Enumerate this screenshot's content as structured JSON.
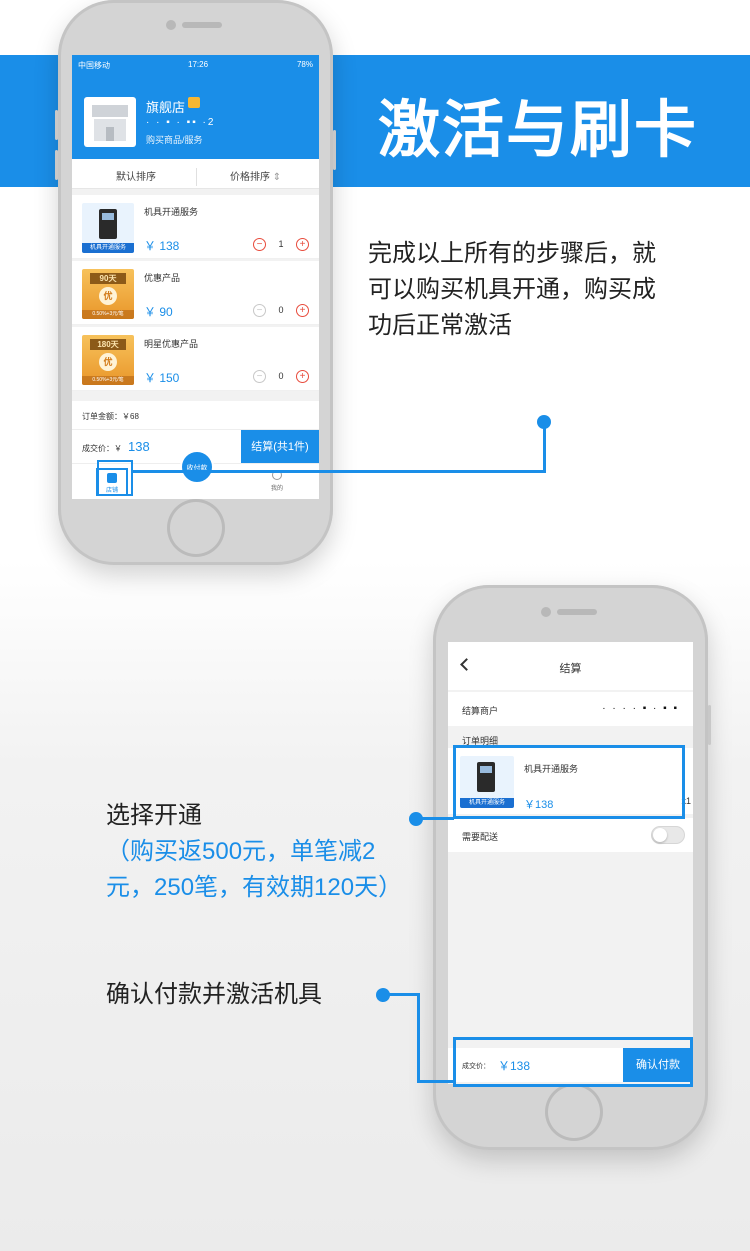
{
  "banner": {
    "title": "激活与刷卡"
  },
  "annotations": {
    "top_note": [
      "完成以上所有的步骤后，就",
      "可以购买机具开通，购买成",
      "功后正常激活"
    ],
    "select_title": "选择开通",
    "select_detail": [
      "（购买返500元，单笔减2",
      "元，250笔，有效期120天）"
    ],
    "confirm_note": "确认付款并激活机具"
  },
  "phone1": {
    "status": {
      "carrier": "中国移动",
      "time": "17:26",
      "battery": "78%"
    },
    "store": {
      "name": "旗舰店",
      "id": "· · ▪ · ▪▪ ·2",
      "subtitle": "购买商品/服务"
    },
    "sort": {
      "default": "默认排序",
      "price": "价格排序"
    },
    "products": [
      {
        "name": "机具开通服务",
        "price": "￥ 138",
        "qty": "1",
        "thumb_label": "机具开通服务"
      },
      {
        "name": "优惠产品",
        "price": "￥ 90",
        "qty": "0",
        "thumb_days": "90天",
        "thumb_badge": "优",
        "thumb_cap": "0.50%+3元/笔"
      },
      {
        "name": "明星优惠产品",
        "price": "￥ 150",
        "qty": "0",
        "thumb_days": "180天",
        "thumb_badge": "优",
        "thumb_cap": "0.50%+3元/笔"
      }
    ],
    "order_total": "订单金额：￥68",
    "deal_label": "成交价：￥",
    "deal_price": "138",
    "pay_button": "结算(共1件)",
    "tabs": {
      "store": "店铺",
      "collect": "收付款",
      "mine": "我的"
    }
  },
  "phone2": {
    "title": "结算",
    "merchant_label": "结算商户",
    "merchant_value": "· · · · ▪ · ▪ ▪",
    "detail_label": "订单明细",
    "item": {
      "name": "机具开通服务",
      "price": "￥138",
      "qty": "x1",
      "thumb_label": "机具开通服务"
    },
    "delivery_label": "需要配送",
    "bottom_label": "成交价：",
    "bottom_price": "￥138",
    "confirm_button": "确认付款"
  },
  "colors": {
    "accent": "#1a8ee8",
    "minus_active": "#e84c3d"
  }
}
